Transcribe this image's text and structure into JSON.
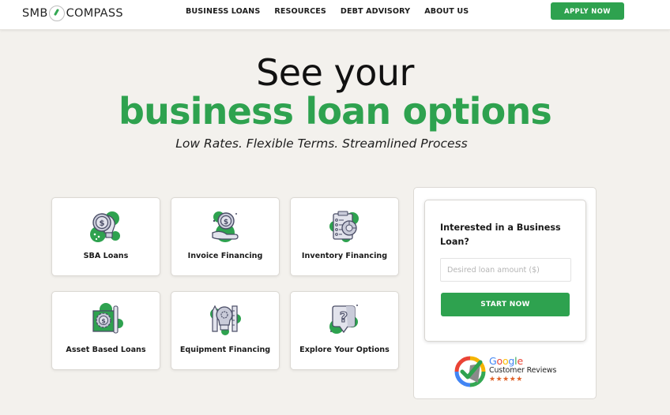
{
  "header": {
    "logo_left": "SMB",
    "logo_right": "COMPASS",
    "nav": [
      {
        "label": "BUSINESS LOANS"
      },
      {
        "label": "RESOURCES"
      },
      {
        "label": "DEBT ADVISORY"
      },
      {
        "label": "ABOUT US"
      }
    ],
    "apply_label": "APPLY NOW"
  },
  "hero": {
    "line1": "See your",
    "line2": "business loan options",
    "subtitle": "Low Rates. Flexible Terms. Streamlined Process"
  },
  "loan_cards": [
    {
      "label": "SBA Loans",
      "icon": "coin-lightbulb-icon"
    },
    {
      "label": "Invoice Financing",
      "icon": "coin-hand-icon"
    },
    {
      "label": "Inventory Financing",
      "icon": "clipboard-chart-icon"
    },
    {
      "label": "Asset Based Loans",
      "icon": "gear-dollar-blueprint-icon"
    },
    {
      "label": "Equipment Financing",
      "icon": "lightbulb-tools-icon"
    },
    {
      "label": "Explore Your Options",
      "icon": "question-bubble-icon"
    }
  ],
  "form": {
    "title": "Interested in a Business Loan?",
    "input_value": "",
    "input_placeholder": "Desired loan amount ($)",
    "submit_label": "START NOW"
  },
  "reviews": {
    "google_letters": [
      "G",
      "o",
      "o",
      "g",
      "l",
      "e"
    ],
    "label": "Customer Reviews",
    "stars": "★★★★★",
    "rating": 5
  },
  "colors": {
    "brand_green": "#2ea24f",
    "background": "#f3f1ed",
    "star_orange": "#e0632a"
  }
}
